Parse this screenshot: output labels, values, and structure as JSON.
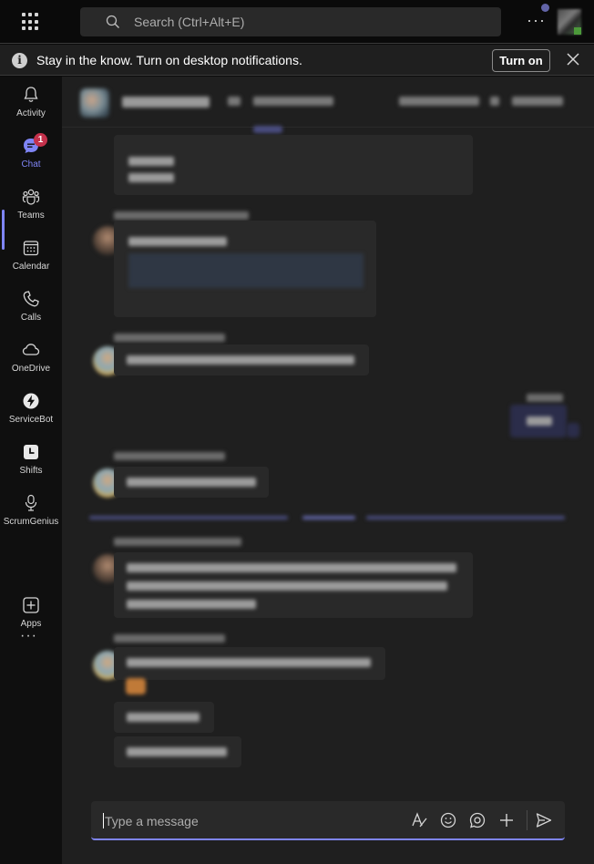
{
  "topbar": {
    "search_placeholder": "Search (Ctrl+Alt+E)",
    "more_label": "···"
  },
  "notification": {
    "info_glyph": "i",
    "message": "Stay in the know. Turn on desktop notifications.",
    "turn_on_label": "Turn on"
  },
  "rail": {
    "items": [
      {
        "label": "Activity",
        "icon": "bell-icon"
      },
      {
        "label": "Chat",
        "icon": "chat-icon"
      },
      {
        "label": "Teams",
        "icon": "teams-icon"
      },
      {
        "label": "Calendar",
        "icon": "calendar-icon"
      },
      {
        "label": "Calls",
        "icon": "phone-icon"
      },
      {
        "label": "OneDrive",
        "icon": "cloud-icon"
      },
      {
        "label": "ServiceBot",
        "icon": "servicebot-icon"
      },
      {
        "label": "Shifts",
        "icon": "clock-icon"
      },
      {
        "label": "ScrumGenius",
        "icon": "scrumgenius-icon"
      },
      {
        "label": "Apps",
        "icon": "plus-square-icon"
      }
    ],
    "chat_badge": "1",
    "more_label": "···"
  },
  "compose": {
    "placeholder": "Type a message"
  },
  "colors": {
    "accent": "#7f85f5",
    "badge": "#c4314b",
    "background": "#1f1f1f",
    "rail": "#0f0f0f"
  }
}
